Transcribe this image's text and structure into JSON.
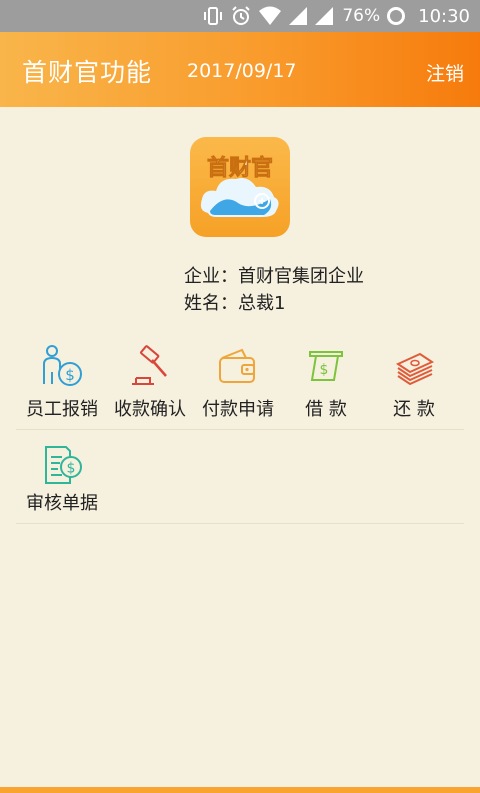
{
  "status_bar": {
    "battery": "76%",
    "time": "10:30",
    "icons": [
      "vibrate-icon",
      "alarm-icon",
      "wifi-icon",
      "signal-icon",
      "signal-icon",
      "battery-ring-icon"
    ]
  },
  "header": {
    "title": "首财官功能",
    "date": "2017/09/17",
    "logout": "注销",
    "gradient": [
      "#f9b54a",
      "#f67b0c"
    ]
  },
  "logo": {
    "text": "首财官",
    "icon": "cloud-logo-icon"
  },
  "info": {
    "company": "企业：首财官集团企业",
    "name": "姓名：总裁1"
  },
  "functions": [
    {
      "label": "员工报销",
      "icon": "employee-reimburse-icon",
      "color": "#2f9fd6"
    },
    {
      "label": "收款确认",
      "icon": "gavel-icon",
      "color": "#d9463a"
    },
    {
      "label": "付款申请",
      "icon": "wallet-icon",
      "color": "#f0a53a"
    },
    {
      "label": "借 款",
      "icon": "cash-bill-icon",
      "color": "#7cc43c"
    },
    {
      "label": "还 款",
      "icon": "money-stack-icon",
      "color": "#e05b3a"
    },
    {
      "label": "审核单据",
      "icon": "audit-document-icon",
      "color": "#2fb59a"
    }
  ]
}
